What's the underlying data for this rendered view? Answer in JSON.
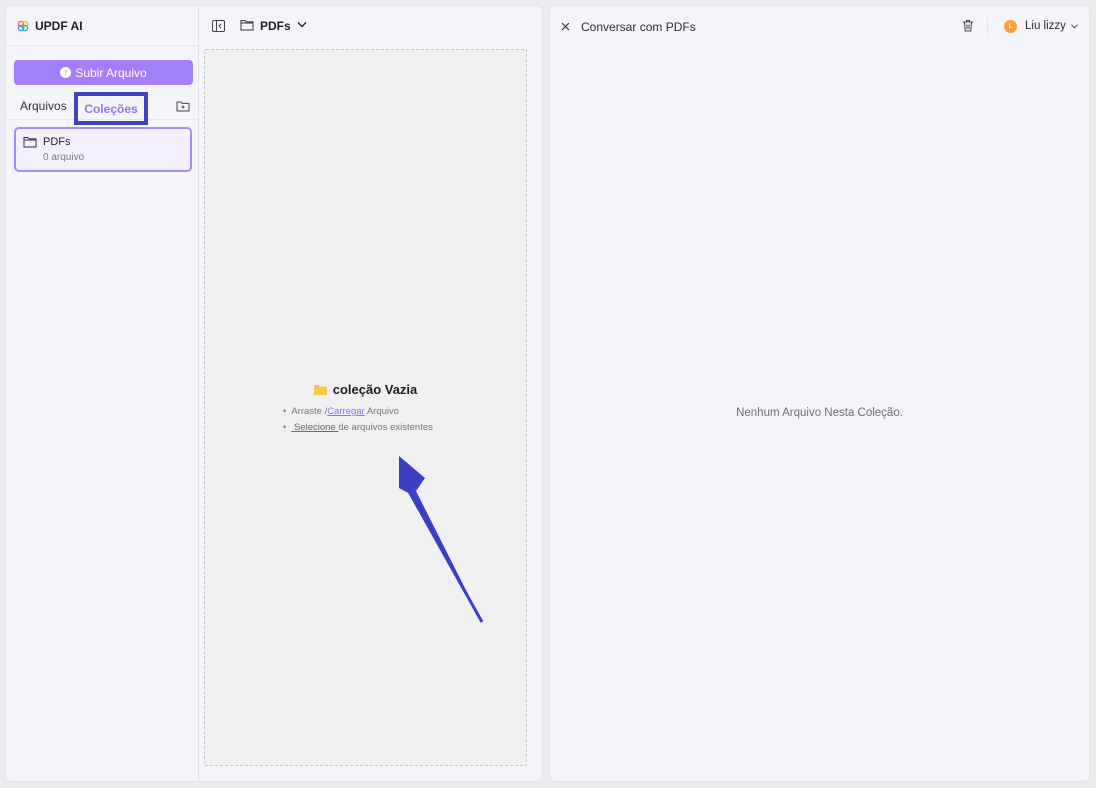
{
  "app": {
    "name": "UPDF AI"
  },
  "sidebar": {
    "upload_label": "Subir Arquivo",
    "tabs": {
      "files": "Arquivos",
      "collections": "Coleções"
    },
    "collections": [
      {
        "name": "PDFs",
        "count": "0 arquivo"
      }
    ]
  },
  "middle": {
    "title": "PDFs",
    "empty": {
      "title": "coleção Vazia",
      "hint1_prefix": "Arraste /",
      "hint1_link": "Carregar",
      "hint1_suffix": " Arquivo",
      "hint2_link": " Selecione ",
      "hint2_suffix": " de arquivos existentes"
    }
  },
  "chat": {
    "title": "Conversar com PDFs",
    "user_initial": "L",
    "user_name": "Liu lizzy",
    "empty_message": "Nenhum Arquivo Nesta Coleção."
  },
  "colors": {
    "accent": "#a47df8",
    "highlight_box": "#4043b8",
    "arrow": "#3b3fc4",
    "folder_yellow": "#f6c84a"
  },
  "icons": [
    "updf-logo-icon",
    "upload-icon",
    "new-folder-icon",
    "folder-icon",
    "collapse-sidebar-icon",
    "chevron-down-icon",
    "close-icon",
    "trash-icon"
  ]
}
